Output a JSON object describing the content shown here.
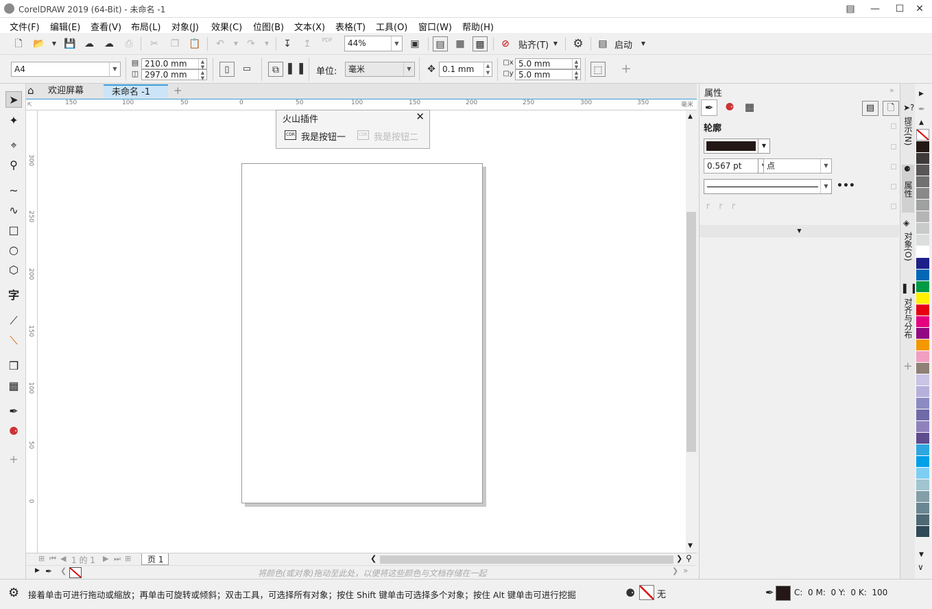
{
  "titlebar": {
    "title": "CorelDRAW 2019 (64-Bit) - 未命名 -1"
  },
  "menu": [
    "文件(F)",
    "编辑(E)",
    "查看(V)",
    "布局(L)",
    "对象(J)",
    "效果(C)",
    "位图(B)",
    "文本(X)",
    "表格(T)",
    "工具(O)",
    "窗口(W)",
    "帮助(H)"
  ],
  "toolbar": {
    "zoom": "44%",
    "snap_label": "贴齐(T)",
    "launch_label": "启动",
    "pdf_label": "PDF"
  },
  "propbar": {
    "page_size": "A4",
    "width": "210.0 mm",
    "height": "297.0 mm",
    "units_label": "单位:",
    "units": "毫米",
    "nudge": "0.1 mm",
    "dup_x": "5.0 mm",
    "dup_y": "5.0 mm"
  },
  "tabs": {
    "welcome": "欢迎屏幕",
    "doc": "未命名 -1"
  },
  "ruler": {
    "h": [
      "150",
      "100",
      "50",
      "0",
      "50",
      "100",
      "150",
      "200",
      "250",
      "300",
      "350"
    ],
    "unit": "毫米",
    "v": [
      "300",
      "250",
      "200",
      "150",
      "100",
      "50",
      "0"
    ]
  },
  "plugin": {
    "title": "火山插件",
    "btn1": "我是按钮一",
    "btn2": "我是按钮二",
    "icon_text": "CDR"
  },
  "pagenav": {
    "pos": "1 的 1",
    "page": "页 1"
  },
  "palette_hint": "将颜色(或对象)拖动至此处，以便将这些颜色与文档存储在一起",
  "status": {
    "text": "接着单击可进行拖动或缩放；再单击可旋转或倾斜；双击工具，可选择所有对象；按住 Shift 键单击可选择多个对象；按住 Alt 键单击可进行挖掘",
    "fill_label": "无",
    "cmyk": "C:  0 M:  0 Y:  0 K:  100"
  },
  "properties": {
    "title": "属性",
    "section": "轮廓",
    "outline_width": "0.567 pt",
    "outline_unit": "点"
  },
  "docker_tabs": [
    "提示(N)",
    "属性",
    "对象(O)",
    "对齐与分布"
  ],
  "palette_colors": [
    "#231815",
    "#3e3a39",
    "#595757",
    "#727171",
    "#898989",
    "#9fa0a0",
    "#b5b5b6",
    "#c9caca",
    "#dcdddd",
    "#ffffff",
    "#1d2088",
    "#0068b7",
    "#009944",
    "#fff100",
    "#e60012",
    "#e4007f",
    "#920783",
    "#f39800",
    "#f19ec2",
    "#8f8177",
    "#c9c3e6",
    "#b6b1dc",
    "#8c8bc1",
    "#6f6aa8",
    "#8f82bc",
    "#5f4c8f",
    "#2ea7e0",
    "#00a0e9",
    "#7ecef4",
    "#a0c4d0",
    "#849ea8",
    "#6a8692",
    "#4e6975",
    "#2f4a58"
  ]
}
